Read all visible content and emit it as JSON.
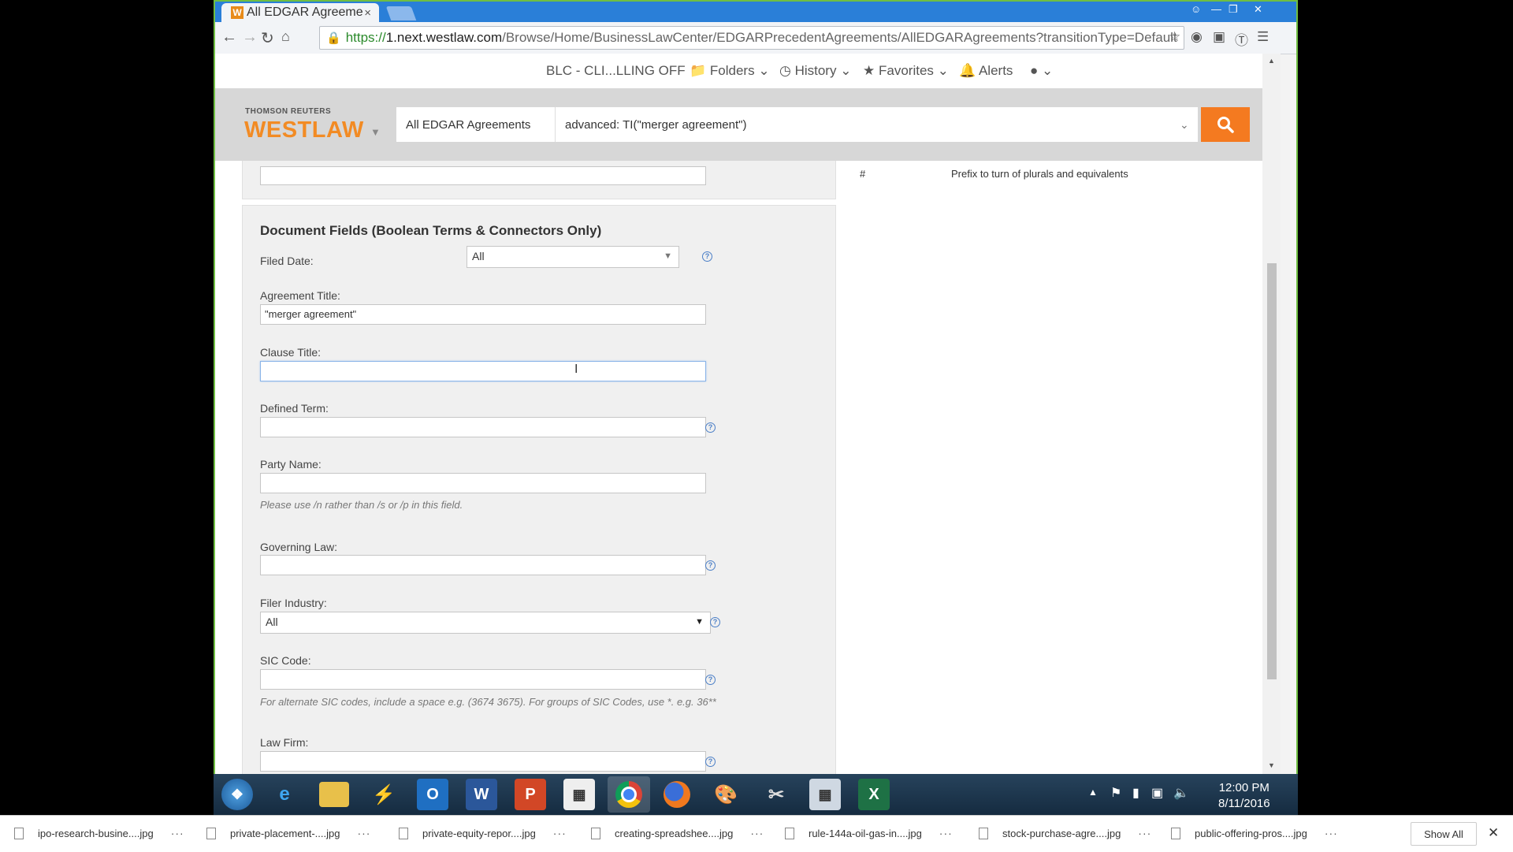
{
  "browser": {
    "tab_title": "All EDGAR Agreeme",
    "tab_close": "×",
    "url_https": "https://",
    "url_host": "1.next.westlaw.com",
    "url_path": "/Browse/Home/BusinessLawCenter/EDGARPrecedentAgreements/AllEDGARAgreements?transitionType=Default"
  },
  "sitebar": {
    "client": "BLC - CLI...LLING OFF",
    "folders": "Folders",
    "history": "History",
    "favorites": "Favorites",
    "alerts": "Alerts"
  },
  "header": {
    "brand_small": "THOMSON REUTERS",
    "brand": "WESTLAW",
    "scope": "All EDGAR Agreements",
    "query": "advanced: TI(\"merger agreement\")"
  },
  "right_panel": {
    "symbol": "#",
    "description": "Prefix to turn of plurals and equivalents"
  },
  "form": {
    "title": "Document Fields (Boolean Terms & Connectors Only)",
    "filed_date_label": "Filed Date:",
    "filed_date_value": "All",
    "agreement_title_label": "Agreement Title:",
    "agreement_title_value": "\"merger agreement\"",
    "clause_title_label": "Clause Title:",
    "clause_title_value": "",
    "defined_term_label": "Defined Term:",
    "party_name_label": "Party Name:",
    "party_name_hint": "Please use /n rather than /s or /p in this field.",
    "governing_law_label": "Governing Law:",
    "filer_industry_label": "Filer Industry:",
    "filer_industry_value": "All",
    "sic_code_label": "SIC Code:",
    "sic_code_hint": "For alternate SIC codes, include a space e.g. (3674 3675). For groups of SIC Codes, use *. e.g. 36**",
    "law_firm_label": "Law Firm:",
    "help_glyph": "?"
  },
  "taskbar": {
    "time": "12:00 PM",
    "date": "8/11/2016"
  },
  "downloads": {
    "items": [
      "ipo-research-busine....jpg",
      "private-placement-....jpg",
      "private-equity-repor....jpg",
      "creating-spreadshee....jpg",
      "rule-144a-oil-gas-in....jpg",
      "stock-purchase-agre....jpg",
      "public-offering-pros....jpg"
    ],
    "more_glyph": "···",
    "show_all": "Show All"
  }
}
